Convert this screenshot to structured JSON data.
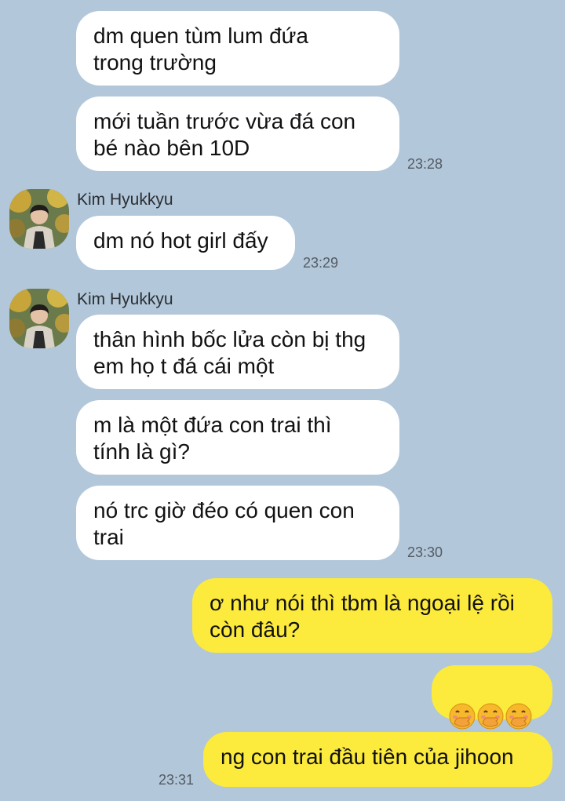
{
  "colors": {
    "background": "#b2c7da",
    "incoming_bubble": "#ffffff",
    "outgoing_bubble": "#fcea3d"
  },
  "messages": {
    "m1": "dm quen tùm lum đứa\ntrong trường",
    "m2": "mới tuần trước vừa đá con\nbé nào bên 10D",
    "t1": "23:28",
    "sender1": "Kim Hyukkyu",
    "m3": "dm nó hot girl đấy",
    "t2": "23:29",
    "sender2": "Kim Hyukkyu",
    "m4": "thân hình bốc lửa còn bị thg\nem họ t đá cái một",
    "m5": "m là một đứa con trai thì\ntính là gì?",
    "m6": "nó trc giờ đéo có quen con\ntrai",
    "t3": "23:30",
    "m7": "ơ như nói thì tbm là ngoại lệ rồi\ncòn đâu?",
    "m8_icons": [
      "hand-over-mouth-emoji",
      "hand-over-mouth-emoji",
      "hand-over-mouth-emoji"
    ],
    "m9": "ng con trai đầu tiên của jihoon",
    "t4": "23:31"
  }
}
